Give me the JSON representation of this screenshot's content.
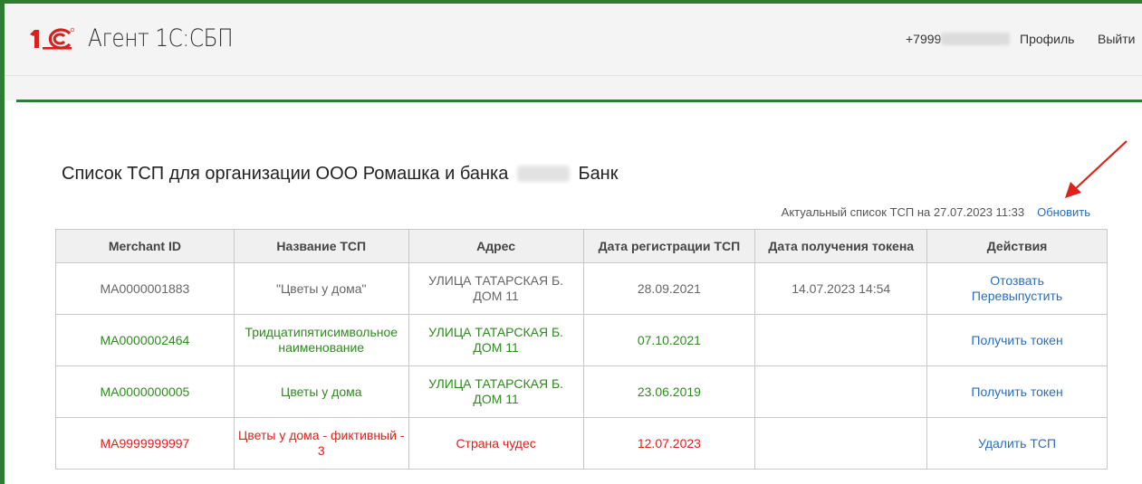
{
  "colors": {
    "frame": "#2e7d32",
    "link": "#2a6ebb",
    "active": "#2e8b1e",
    "fictive": "#e0201b",
    "default": "#666666",
    "arrow": "#e0201b"
  },
  "header": {
    "logo": "1С",
    "app_title": "Агент 1С:СБП",
    "phone_prefix": "+7999",
    "profile": "Профиль",
    "logout": "Выйти"
  },
  "main": {
    "title_prefix": "Список ТСП для организации ООО Ромашка и банка",
    "title_suffix": "Банк",
    "updated_text": "Актуальный список ТСП на 27.07.2023 11:33",
    "refresh": "Обновить"
  },
  "table": {
    "headers": [
      "Merchant ID",
      "Название ТСП",
      "Адрес",
      "Дата регистрации ТСП",
      "Дата получения токена",
      "Действия"
    ],
    "rows": [
      {
        "status": "gray",
        "id": "MA0000001883",
        "name": "\"Цветы у дома\"",
        "address": "УЛИЦА ТАТАРСКАЯ Б. ДОМ 11",
        "reg_date": "28.09.2021",
        "token_date": "14.07.2023 14:54",
        "actions": [
          "Отозвать",
          "Перевыпустить"
        ]
      },
      {
        "status": "green",
        "id": "MA0000002464",
        "name": "Тридцатипятисимвольное наименование",
        "address": "УЛИЦА ТАТАРСКАЯ Б. ДОМ 11",
        "reg_date": "07.10.2021",
        "token_date": "",
        "actions": [
          "Получить токен"
        ]
      },
      {
        "status": "green",
        "id": "MA0000000005",
        "name": "Цветы у дома",
        "address": "УЛИЦА ТАТАРСКАЯ Б. ДОМ 11",
        "reg_date": "23.06.2019",
        "token_date": "",
        "actions": [
          "Получить токен"
        ]
      },
      {
        "status": "red",
        "id": "MA9999999997",
        "name": "Цветы у дома - фиктивный - 3",
        "address": "Страна чудес",
        "reg_date": "12.07.2023",
        "token_date": "",
        "actions": [
          "Удалить ТСП"
        ]
      }
    ]
  }
}
